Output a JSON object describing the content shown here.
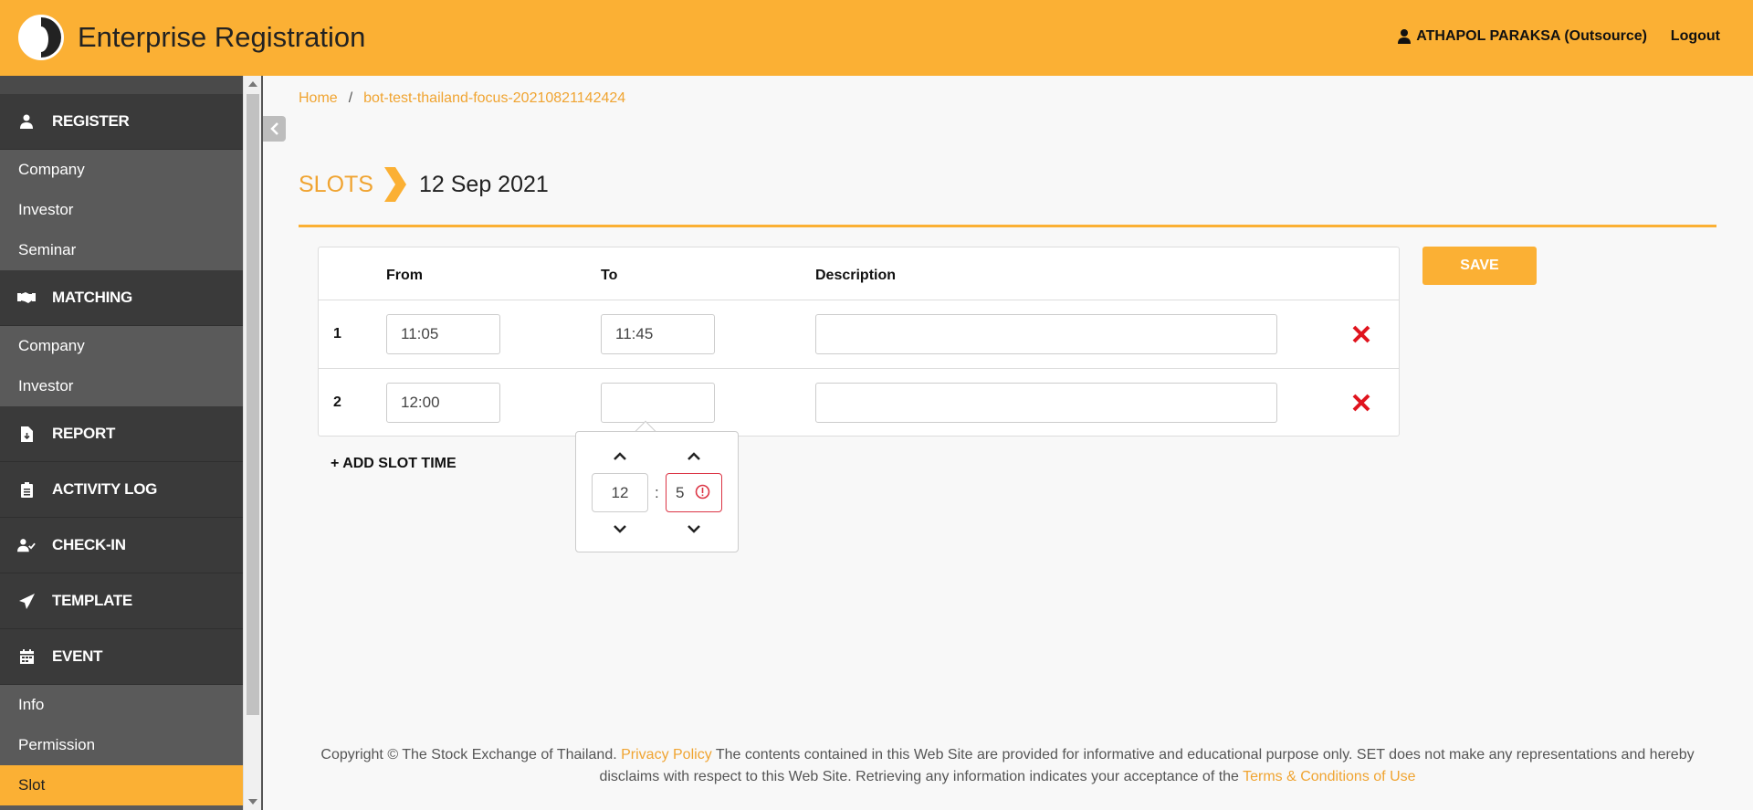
{
  "app": {
    "title": "Enterprise Registration",
    "logo_icon": "set-logo-icon"
  },
  "header": {
    "user_name": "ATHAPOL PARAKSA (Outsource)",
    "logout_label": "Logout",
    "brand_color": "#fbb034"
  },
  "sidebar": {
    "sections": [
      {
        "label": "REGISTER",
        "icon": "user-icon",
        "items": [
          "Company",
          "Investor",
          "Seminar"
        ]
      },
      {
        "label": "MATCHING",
        "icon": "handshake-icon",
        "items": [
          "Company",
          "Investor"
        ]
      },
      {
        "label": "REPORT",
        "icon": "file-download-icon",
        "items": []
      },
      {
        "label": "ACTIVITY LOG",
        "icon": "clipboard-icon",
        "items": []
      },
      {
        "label": "CHECK-IN",
        "icon": "user-check-icon",
        "items": []
      },
      {
        "label": "TEMPLATE",
        "icon": "paper-plane-icon",
        "items": []
      },
      {
        "label": "EVENT",
        "icon": "calendar-icon",
        "items": [
          "Info",
          "Permission",
          "Slot"
        ]
      }
    ],
    "active_item": "Slot"
  },
  "breadcrumb": {
    "home": "Home",
    "separator": "/",
    "current": "bot-test-thailand-focus-20210821142424"
  },
  "page": {
    "section_title": "SLOTS",
    "date": "12 Sep 2021"
  },
  "table": {
    "headers": {
      "from": "From",
      "to": "To",
      "description": "Description"
    },
    "rows": [
      {
        "num": "1",
        "from": "11:05",
        "to": "11:45",
        "description": ""
      },
      {
        "num": "2",
        "from": "12:00",
        "to": "",
        "description": ""
      }
    ]
  },
  "actions": {
    "save_label": "SAVE",
    "add_slot_label": "+ ADD SLOT TIME"
  },
  "time_picker": {
    "hours": "12",
    "separator": ":",
    "minutes": "5",
    "minutes_invalid": true
  },
  "footer": {
    "text1": "Copyright © The Stock Exchange of Thailand. ",
    "privacy": "Privacy Policy",
    "text2": " The contents contained in this Web Site are provided for informative and educational purpose only. SET does not make any representations and hereby disclaims with respect to this Web Site. Retrieving any information indicates your acceptance of the ",
    "terms": "Terms & Conditions of Use"
  }
}
